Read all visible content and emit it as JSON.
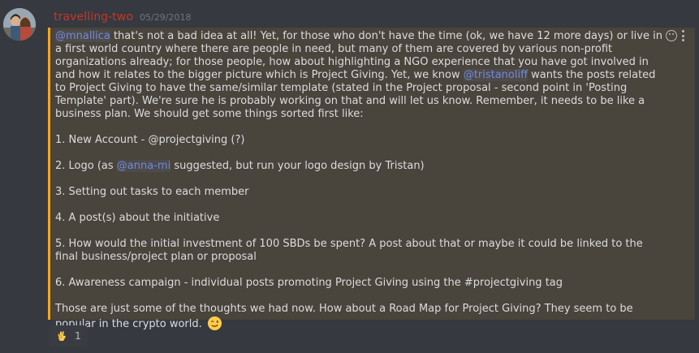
{
  "message": {
    "username": "travelling-two",
    "timestamp": "05/29/2018",
    "avatar_icon": "avatar-photo",
    "accent_color": "#faa61a",
    "username_color": "#c0392b",
    "paragraph1": {
      "mention1": "@mnallica",
      "text1": " that's not a bad idea at all! Yet, for those who don't have the time (ok, we have 12 more days) or live in a first world country where there are people in need, but many of them are covered by various non-profit organizations already; for those people, how about highlighting a NGO experience that you have got involved in and how it relates to the bigger picture which is Project Giving. Yet, we know ",
      "mention2": "@tristanoliff",
      "text2": " wants the posts related to Project Giving to have the same/similar template (stated in the Project proposal - second point in 'Posting Template' part). We're sure he is probably working on that and will let us know. Remember, it needs to be like a business plan. We should get some things sorted first like:"
    },
    "item1": "1. New Account - @projectgiving (?)",
    "item2": {
      "before": "2. Logo (as ",
      "mention": "@anna-mi",
      "after": " suggested, but run your logo design by Tristan)"
    },
    "item3": "3. Setting out tasks to each member",
    "item4": "4. A post(s) about the initiative",
    "item5": "5. How would the initial investment of 100 SBDs be spent? A post about that or maybe it could be linked to the final business/project plan or proposal",
    "item6": "6. Awareness campaign - individual posts promoting Project Giving using the #projectgiving tag",
    "closing": "Those are just some of the thoughts we had now. How about a Road Map for Project Giving? They seem to be popular in the crypto world.",
    "closing_emoji": "wink-emoji"
  },
  "actions": {
    "add_reaction_icon": "add-reaction-icon",
    "more_icon": "more-options-icon"
  },
  "reaction": {
    "emoji": "ok-hand-emoji",
    "count": "1"
  }
}
